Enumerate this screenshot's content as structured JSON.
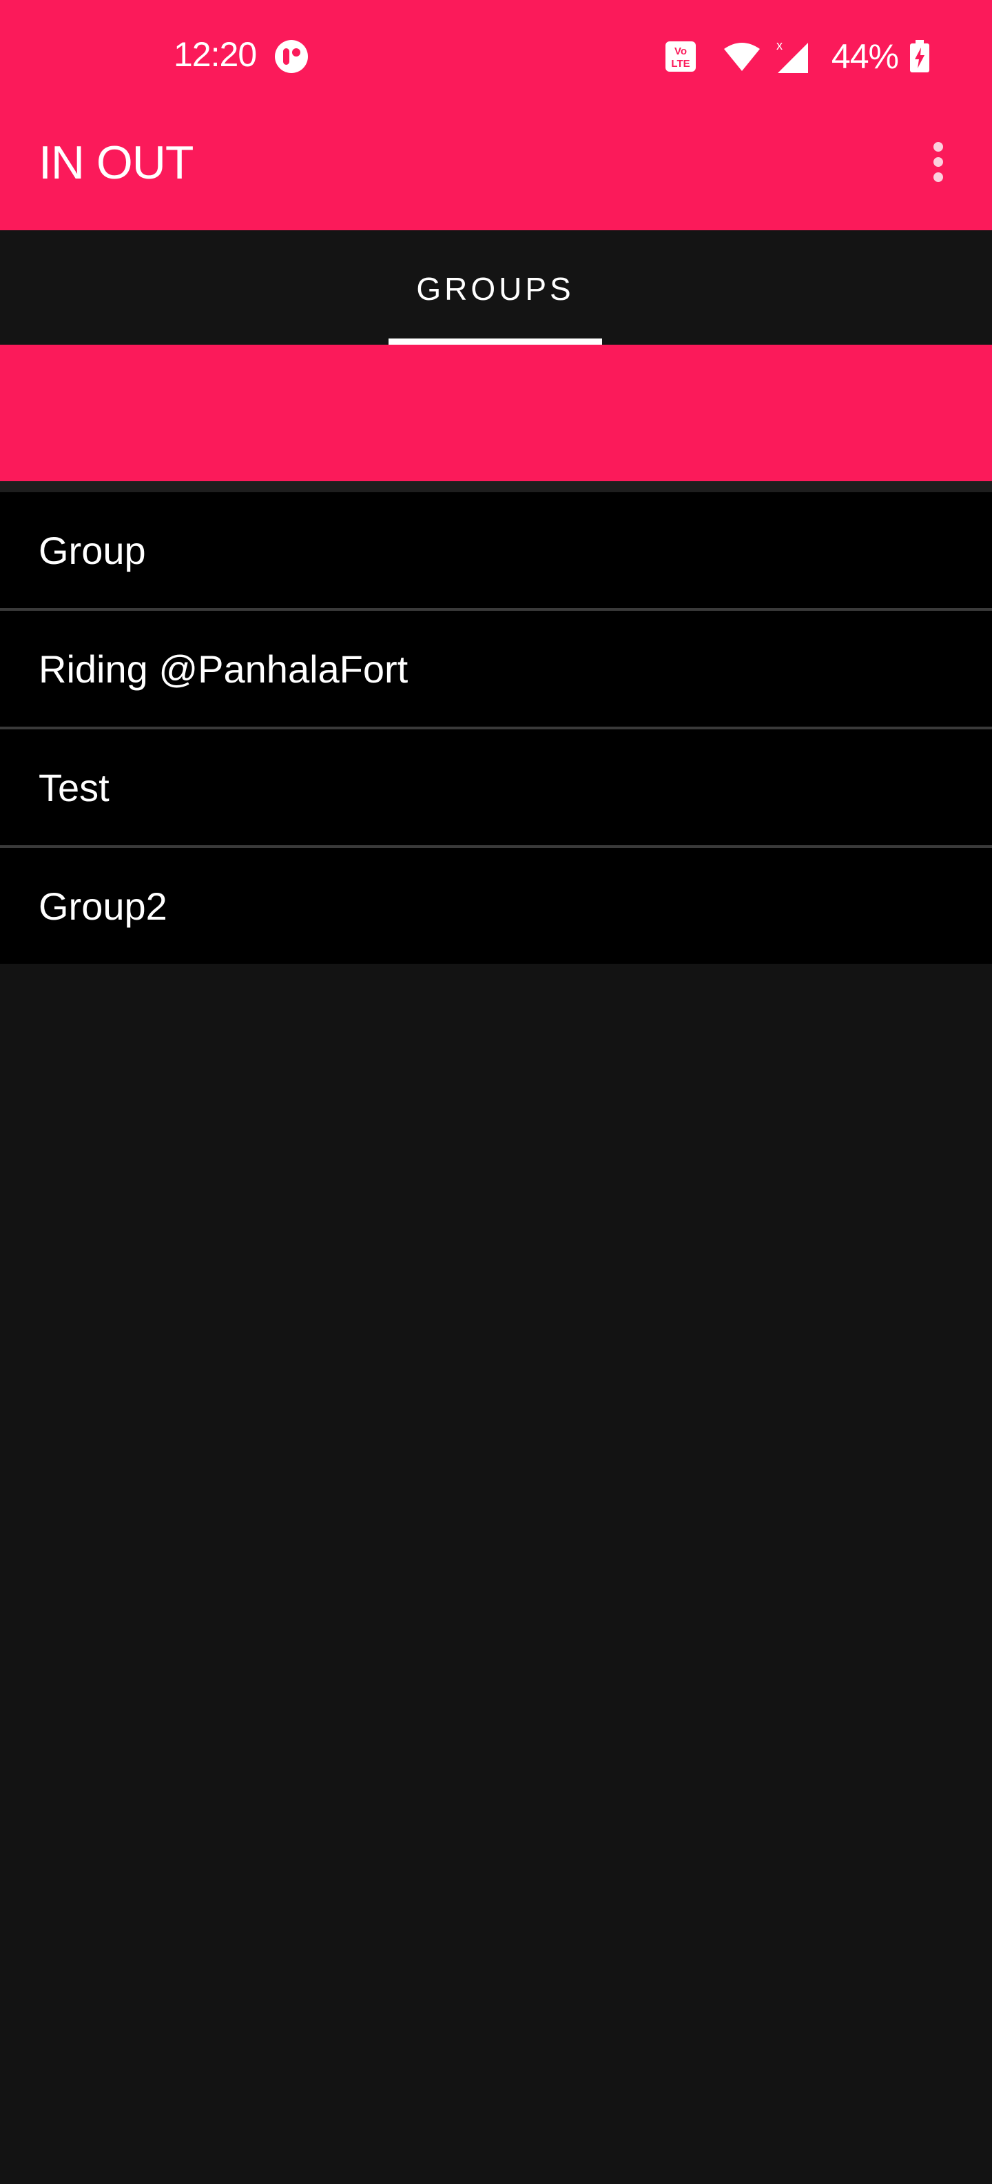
{
  "status_bar": {
    "time": "12:20",
    "battery_percent": "44%",
    "icons": [
      "app-notification-icon",
      "volte-icon",
      "wifi-icon",
      "cell-signal-icon",
      "battery-charging-icon"
    ]
  },
  "app_bar": {
    "title": "IN OUT",
    "menu_icon": "overflow-menu-icon"
  },
  "tabs": [
    {
      "label": "GROUPS",
      "selected": true
    }
  ],
  "groups": [
    {
      "name": "Group"
    },
    {
      "name": "Riding @PanhalaFort"
    },
    {
      "name": "Test"
    },
    {
      "name": "Group2"
    }
  ],
  "colors": {
    "accent": "#fb1a5a",
    "background": "#131313",
    "list_background": "#000000",
    "text": "#ffffff"
  }
}
